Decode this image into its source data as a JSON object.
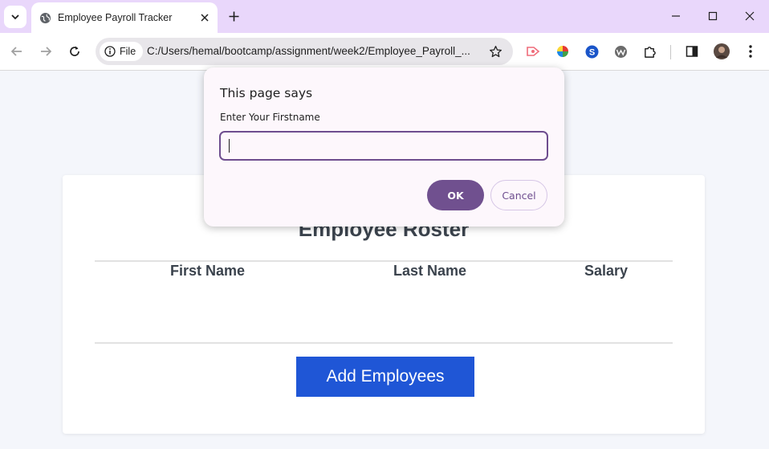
{
  "browser": {
    "tab_title": "Employee Payroll Tracker",
    "address_chip": "File",
    "url": "C:/Users/hemal/bootcamp/assignment/week2/Employee_Payroll_...",
    "extension_profile_letter": "S"
  },
  "page": {
    "title": "Employee Roster",
    "columns": [
      "First Name",
      "Last Name",
      "Salary"
    ],
    "add_button_label": "Add Employees"
  },
  "dialog": {
    "title": "This page says",
    "message": "Enter Your Firstname",
    "input_value": "",
    "ok_label": "OK",
    "cancel_label": "Cancel"
  },
  "colors": {
    "tabstrip": "#e9d7fb",
    "primary_button": "#1f56d6",
    "dialog_accent": "#70508f"
  }
}
